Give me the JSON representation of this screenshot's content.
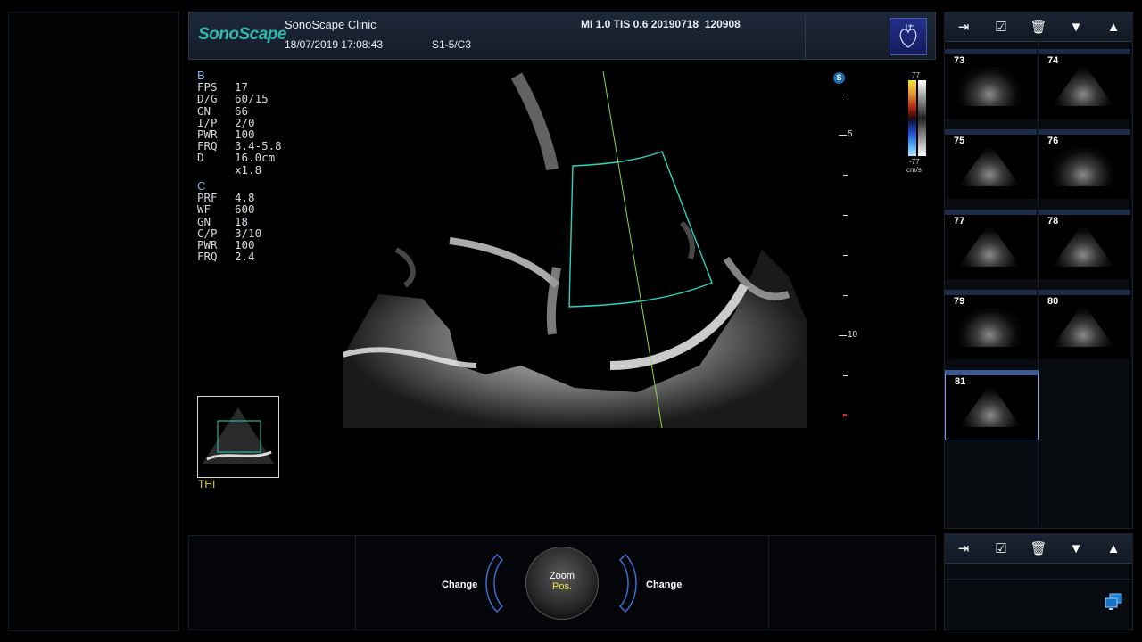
{
  "header": {
    "logo": "SonoScape",
    "clinic": "SonoScape Clinic",
    "datetime": "18/07/2019 17:08:43",
    "probe": "S1-5/C3",
    "params": "MI  1.0  TIS 0.6  20190718_120908"
  },
  "b_params": {
    "title": "B",
    "rows": [
      {
        "k": "FPS",
        "v": "17"
      },
      {
        "k": "D/G",
        "v": "60/15"
      },
      {
        "k": "GN",
        "v": "66"
      },
      {
        "k": "I/P",
        "v": "2/0"
      },
      {
        "k": "PWR",
        "v": "100"
      },
      {
        "k": "FRQ",
        "v": "3.4-5.8"
      },
      {
        "k": "D",
        "v": "16.0cm"
      },
      {
        "k": "",
        "v": "x1.8"
      }
    ]
  },
  "c_params": {
    "title": "C",
    "rows": [
      {
        "k": "PRF",
        "v": "4.8"
      },
      {
        "k": "WF",
        "v": "600"
      },
      {
        "k": "GN",
        "v": "18"
      },
      {
        "k": "C/P",
        "v": "3/10"
      },
      {
        "k": "PWR",
        "v": "100"
      },
      {
        "k": "FRQ",
        "v": "2.4"
      }
    ]
  },
  "thi_label": "THI",
  "depth_labels": {
    "d5": "5",
    "d10": "10"
  },
  "color_scale": {
    "top": "77",
    "bottom": "-77",
    "unit": "cm/s",
    "mode_icon": "S"
  },
  "toolbar": {
    "export_icon": "export-icon",
    "report_icon": "report-icon",
    "delete_icon": "trash-icon",
    "down_icon": "triangle-down-icon",
    "up_icon": "triangle-up-icon",
    "glyph_export": "⇥",
    "glyph_report": "☑",
    "glyph_delete": "🗑",
    "glyph_down": "▼",
    "glyph_up": "▲"
  },
  "thumbnails": [
    {
      "num": "73"
    },
    {
      "num": "74"
    },
    {
      "num": "75"
    },
    {
      "num": "76"
    },
    {
      "num": "77"
    },
    {
      "num": "78"
    },
    {
      "num": "79"
    },
    {
      "num": "80"
    },
    {
      "num": "81",
      "selected": true
    }
  ],
  "bottom": {
    "change_left": "Change",
    "change_right": "Change",
    "knob_line1": "Zoom",
    "knob_line2": "Pos."
  },
  "colors": {
    "accent": "#2fb6b0",
    "sector_box": "#29d3c0",
    "doppler_line": "#8fd84a",
    "thi": "#d8d430"
  }
}
